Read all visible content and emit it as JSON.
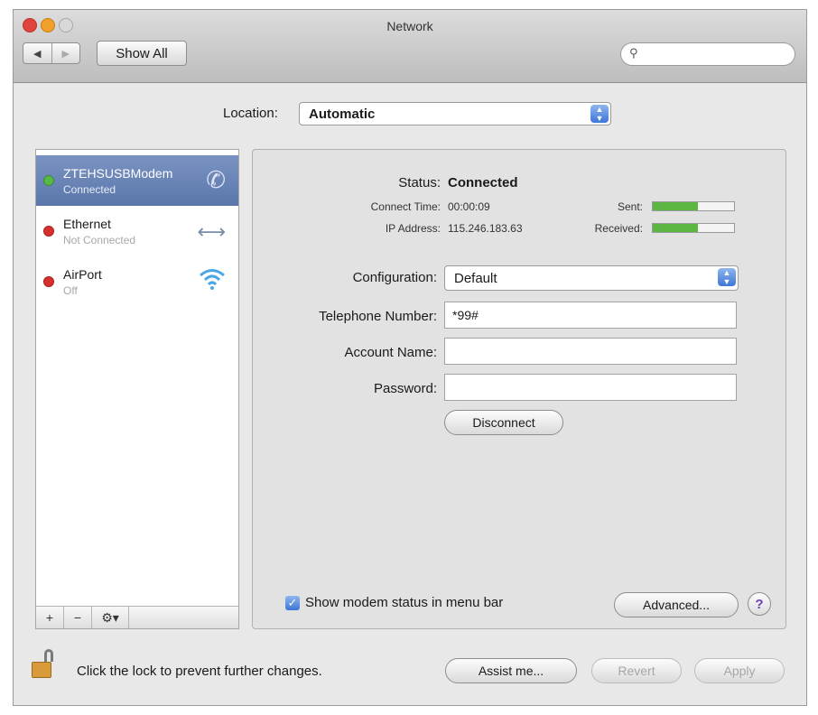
{
  "window": {
    "title": "Network"
  },
  "toolbar": {
    "back_icon": "◀",
    "forward_icon": "▶",
    "show_all": "Show All",
    "search_placeholder": "",
    "search_icon": "🔍"
  },
  "location": {
    "label": "Location:",
    "value": "Automatic"
  },
  "services": [
    {
      "name": "ZTEHSUSBModem",
      "status": "Connected",
      "indicator": "green",
      "icon": "phone-icon",
      "selected": true
    },
    {
      "name": "Ethernet",
      "status": "Not Connected",
      "indicator": "red",
      "icon": "ethernet-arrows-icon",
      "selected": false
    },
    {
      "name": "AirPort",
      "status": "Off",
      "indicator": "red",
      "icon": "wifi-icon",
      "selected": false
    }
  ],
  "sidebar_buttons": {
    "add": "+",
    "remove": "−",
    "action": "⚙▾"
  },
  "detail": {
    "status_label": "Status:",
    "status_value": "Connected",
    "connect_time_label": "Connect Time:",
    "connect_time_value": "00:00:09",
    "ip_label": "IP Address:",
    "ip_value": "115.246.183.63",
    "sent_label": "Sent:",
    "received_label": "Received:",
    "sent_level": 0.55,
    "received_level": 0.55,
    "configuration_label": "Configuration:",
    "configuration_value": "Default",
    "telephone_label": "Telephone Number:",
    "telephone_value": "*99#",
    "account_label": "Account Name:",
    "account_value": "",
    "password_label": "Password:",
    "password_value": "",
    "disconnect": "Disconnect",
    "show_modem_status": "Show modem status in menu bar",
    "show_modem_status_checked": true,
    "advanced": "Advanced...",
    "help": "?"
  },
  "footer": {
    "lock_text": "Click the lock to prevent further changes.",
    "assist": "Assist me...",
    "revert": "Revert",
    "apply": "Apply"
  },
  "colors": {
    "selected_row": "#6a84b8",
    "connected_dot": "#56b84a",
    "disconnected_dot": "#d8302e",
    "meter_fill": "#5bb642"
  }
}
